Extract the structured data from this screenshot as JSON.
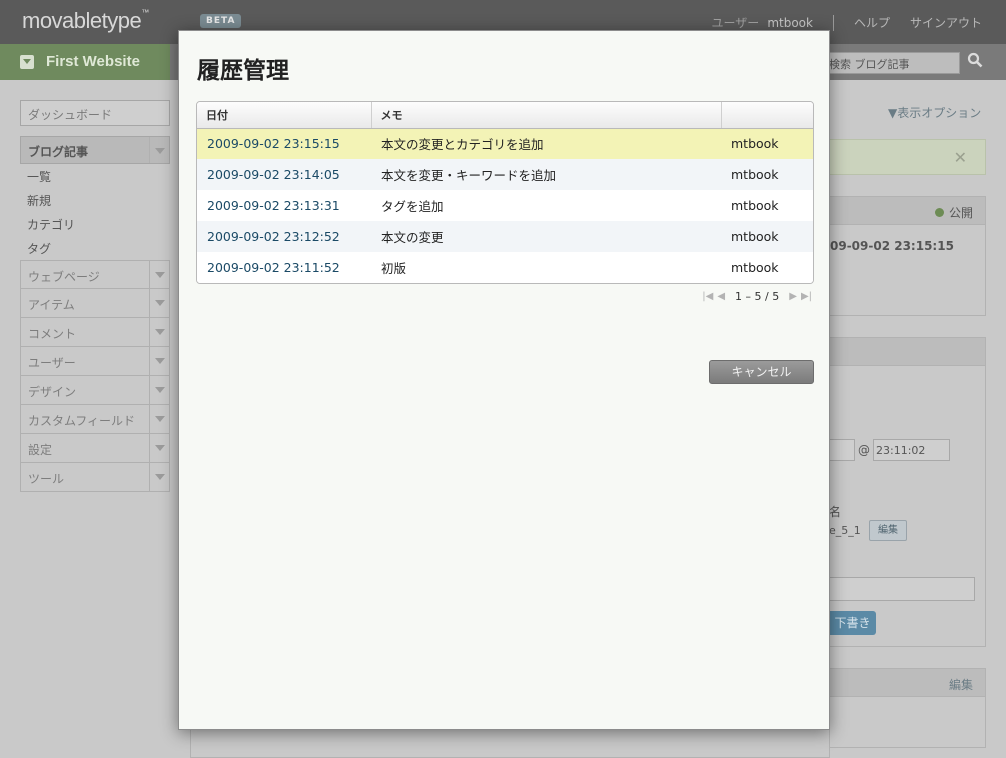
{
  "app": {
    "logo": "movabletype",
    "logo_tm": "™",
    "beta": "BETA",
    "user_label": "ユーザー",
    "user_name": "mtbook",
    "help": "ヘルプ",
    "signout": "サインアウト"
  },
  "site": {
    "name": "First Website",
    "search_placeholder": "検索 ブログ記事"
  },
  "sidebar": {
    "dashboard": "ダッシュボード",
    "group": "ブログ記事",
    "subitems": [
      "一覧",
      "新規",
      "カテゴリ",
      "タグ"
    ],
    "items": [
      "ウェブページ",
      "アイテム",
      "コメント",
      "ユーザー",
      "デザイン",
      "カスタムフィールド",
      "設定",
      "ツール"
    ]
  },
  "right": {
    "display_options": "▼表示オプション",
    "status": "公開",
    "datetime": "09-09-02 23:15:15",
    "time": "23:11:02",
    "at": "@",
    "name_label": "名",
    "basename": "e_5_1",
    "edit_small": "編集",
    "draft": "下書き",
    "edit": "編集"
  },
  "modal": {
    "title": "履歴管理",
    "columns": [
      "日付",
      "メモ",
      ""
    ],
    "rows": [
      {
        "date": "2009-09-02 23:15:15",
        "memo": "本文の変更とカテゴリを追加",
        "user": "mtbook"
      },
      {
        "date": "2009-09-02 23:14:05",
        "memo": "本文を変更・キーワードを追加",
        "user": "mtbook"
      },
      {
        "date": "2009-09-02 23:13:31",
        "memo": "タグを追加",
        "user": "mtbook"
      },
      {
        "date": "2009-09-02 23:12:52",
        "memo": "本文の変更",
        "user": "mtbook"
      },
      {
        "date": "2009-09-02 23:11:52",
        "memo": "初版",
        "user": "mtbook"
      }
    ],
    "pager": "1 – 5 / 5",
    "cancel": "キャンセル"
  },
  "icons": {
    "search": "search-icon",
    "close": "close-icon",
    "check": "check-icon",
    "first": "first-page-icon",
    "prev": "prev-page-icon",
    "next": "next-page-icon",
    "last": "last-page-icon"
  }
}
